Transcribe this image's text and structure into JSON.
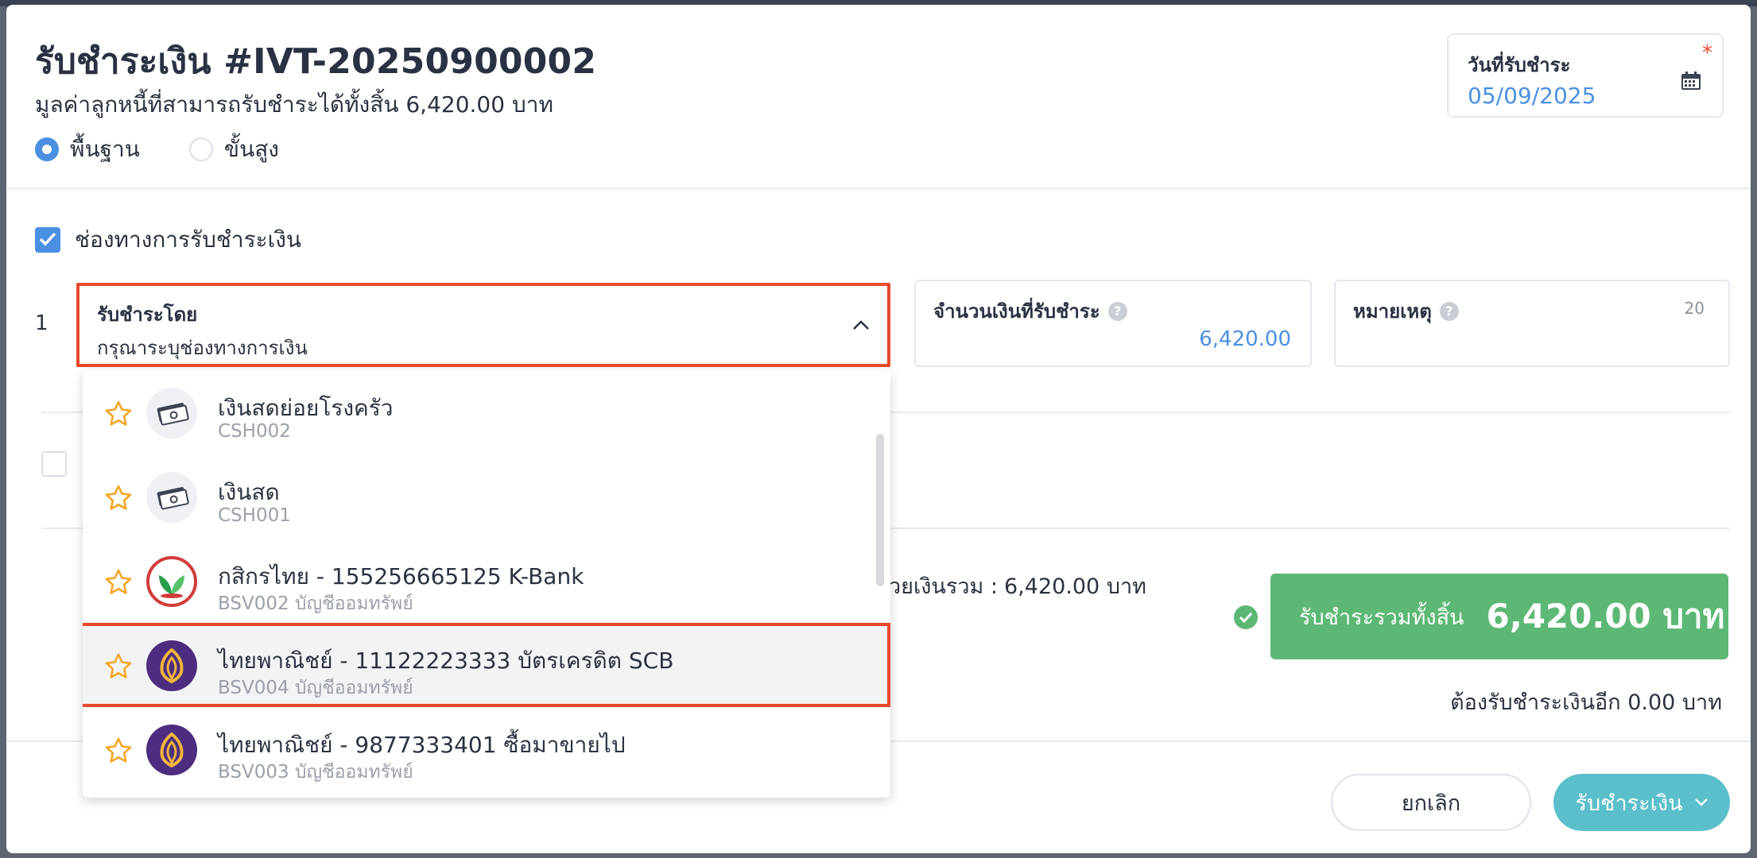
{
  "header": {
    "title": "รับชำระเงิน #IVT-20250900002",
    "subtitle": "มูลค่าลูกหนี้ที่สามารถรับชำระได้ทั้งสิ้น 6,420.00 บาท",
    "modes": [
      {
        "label": "พื้นฐาน",
        "selected": true
      },
      {
        "label": "ขั้นสูง",
        "selected": false
      }
    ]
  },
  "date_field": {
    "label": "วันที่รับชำระ",
    "required_mark": "*",
    "value": "05/09/2025",
    "icon": "calendar-icon"
  },
  "payment_channel": {
    "checkbox_label": "ช่องทางการรับชำระเงิน",
    "checked": true,
    "row_number": "1",
    "pay_by": {
      "label": "รับชำระโดย",
      "placeholder": "กรุณาระบุช่องทางการเงิน"
    },
    "amount": {
      "label": "จำนวนเงินที่รับชำระ",
      "help": "?",
      "value": "6,420.00"
    },
    "note": {
      "label": "หมายเหตุ",
      "help": "?",
      "char_limit": "20"
    }
  },
  "dropdown": {
    "items": [
      {
        "name": "เงินสดย่อยโรงครัว",
        "code": "CSH002",
        "icon": "cash-icon"
      },
      {
        "name": "เงินสด",
        "code": "CSH001",
        "icon": "cash-icon"
      },
      {
        "name": "กสิกรไทย - 155256665125 K-Bank",
        "code": "BSV002 บัญชีออมทรัพย์",
        "icon": "kbank-logo-icon"
      },
      {
        "name": "ไทยพาณิชย์ - 11122223333 บัตรเครดิต SCB",
        "code": "BSV004 บัญชีออมทรัพย์",
        "icon": "scb-logo-icon"
      },
      {
        "name": "ไทยพาณิชย์ - 9877333401 ซื้อมาขายไป",
        "code": "BSV003 บัญชีออมทรัพย์",
        "icon": "scb-logo-icon"
      }
    ]
  },
  "summary": {
    "sum_text": "วยเงินรวม :",
    "sum_value": "6,420.00 บาท",
    "total_label": "รับชำระรวมทั้งสิ้น",
    "total_value": "6,420.00 บาท",
    "remaining": "ต้องรับชำระเงินอีก 0.00 บาท"
  },
  "footer": {
    "cancel_label": "ยกเลิก",
    "submit_label": "รับชำระเงิน"
  },
  "colors": {
    "accent": "#4a90e2",
    "highlight": "#e8492c",
    "success": "#5cb874",
    "submit": "#5bbfcb"
  }
}
